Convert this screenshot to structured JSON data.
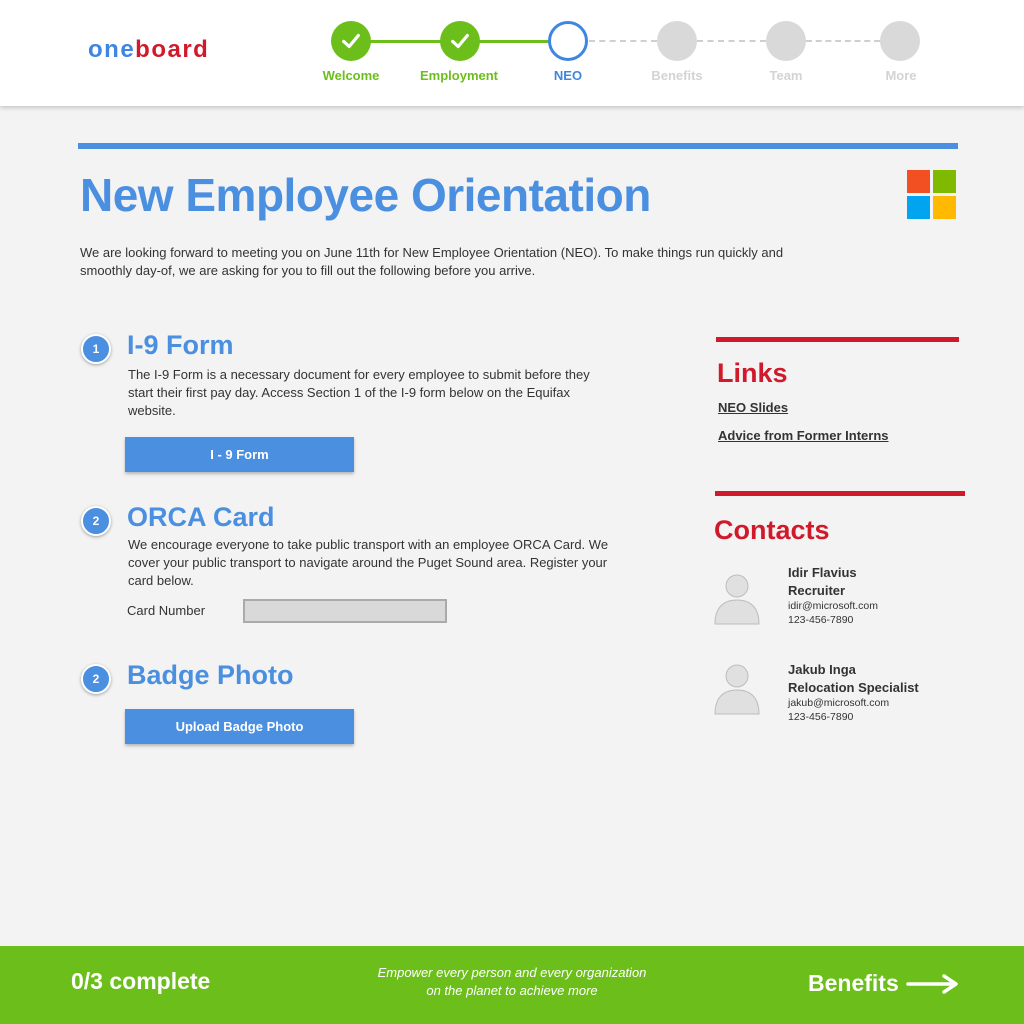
{
  "brand": {
    "part1": "one",
    "part2": "board"
  },
  "steps": [
    {
      "label": "Welcome",
      "state": "done"
    },
    {
      "label": "Employment",
      "state": "done"
    },
    {
      "label": "NEO",
      "state": "current"
    },
    {
      "label": "Benefits",
      "state": "todo"
    },
    {
      "label": "Team",
      "state": "todo"
    },
    {
      "label": "More",
      "state": "todo"
    }
  ],
  "page": {
    "title": "New Employee Orientation",
    "intro_line1": "We are looking forward to meeting you on June 11th for New Employee Orientation (NEO). To make things run quickly and",
    "intro_line2": "smoothly day-of, we are asking for you to fill out the following before  you arrive."
  },
  "sections": [
    {
      "number": "1",
      "title": "I-9 Form",
      "text": "The I-9 Form is a necessary document for every employee to submit before they start their first pay day.  Access Section 1 of the I-9 form below on the Equifax website.",
      "button": "I - 9 Form"
    },
    {
      "number": "2",
      "title": "ORCA Card",
      "text": "We encourage everyone to take public transport with an employee ORCA Card.  We cover your public transport to navigate around the Puget Sound area. Register your card below.",
      "field_label": "Card Number",
      "field_value": ""
    },
    {
      "number": "2",
      "title": "Badge Photo",
      "button": "Upload Badge Photo"
    }
  ],
  "links": {
    "title": "Links",
    "items": [
      "NEO Slides",
      "Advice from Former Interns"
    ]
  },
  "contacts": {
    "title": "Contacts",
    "people": [
      {
        "name": "Idir Flavius",
        "role": "Recruiter",
        "email": "idir@microsoft.com",
        "phone": "123-456-7890"
      },
      {
        "name": "Jakub Inga",
        "role": "Relocation Specialist",
        "email": "jakub@microsoft.com",
        "phone": "123-456-7890"
      }
    ]
  },
  "footer": {
    "progress": "0/3 complete",
    "tagline_line1": "Empower every person and every organization",
    "tagline_line2": "on the planet to achieve more",
    "next_label": "Benefits"
  },
  "colors": {
    "accent_blue": "#4a8fe0",
    "brand_red": "#d01a2c",
    "success_green": "#6cbf1a",
    "ms_red": "#f25022",
    "ms_green": "#7fba00",
    "ms_blue": "#00a4ef",
    "ms_yellow": "#ffb900"
  }
}
